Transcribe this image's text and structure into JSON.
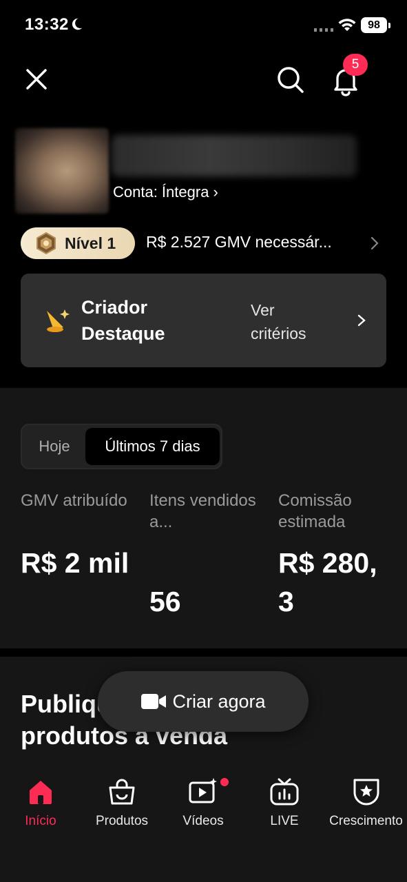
{
  "status_bar": {
    "time": "13:32",
    "battery": "98"
  },
  "header": {
    "notification_count": "5"
  },
  "profile": {
    "account_status": "Conta: Íntegra"
  },
  "level": {
    "label": "Nível 1",
    "gmv_needed": "R$ 2.527 GMV necessár..."
  },
  "creator_card": {
    "title": "Criador Destaque",
    "criteria_link": "Ver critérios"
  },
  "period_toggle": {
    "options": [
      "Hoje",
      "Últimos 7 dias"
    ],
    "selected": "Últimos 7 dias"
  },
  "metrics": [
    {
      "label": "GMV atribuído",
      "value": "R$ 2 mil"
    },
    {
      "label": "Itens vendidos a...",
      "value": "56"
    },
    {
      "label": "Comissão estimada",
      "value": "R$ 280,3"
    }
  ],
  "publish": {
    "title": "Publique um vídeo com produtos à venda"
  },
  "create_button": {
    "label": "Criar agora"
  },
  "tabbar": {
    "items": [
      {
        "label": "Início",
        "icon": "home-icon",
        "active": true
      },
      {
        "label": "Produtos",
        "icon": "shopping-bag-icon"
      },
      {
        "label": "Vídeos",
        "icon": "video-play-icon",
        "dot": true
      },
      {
        "label": "LIVE",
        "icon": "live-tv-icon"
      },
      {
        "label": "Crescimento",
        "icon": "star-badge-icon"
      }
    ]
  },
  "colors": {
    "accent": "#fe2c55",
    "card": "#2f2f2f",
    "section": "#161616",
    "level_pill": "#f3e4c6"
  }
}
